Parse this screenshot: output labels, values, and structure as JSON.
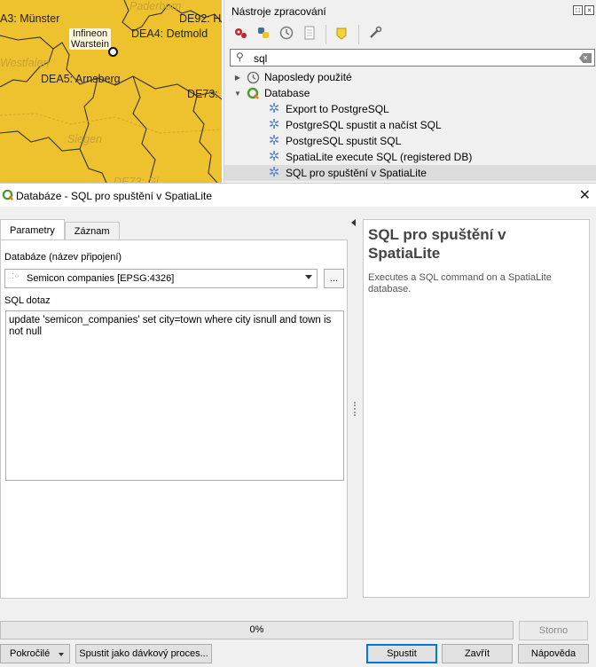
{
  "map": {
    "labels": [
      "A3: Münster",
      "Paderborn",
      "DE92: H",
      "DEA4: Detmold",
      "Westfalen",
      "DEA5: Arnsberg",
      "DE73:",
      "Siegen",
      "DE73: Gi"
    ],
    "poi_label_line1": "Infineon",
    "poi_label_line2": "Warstein"
  },
  "processing": {
    "title": "Nástroje zpracování",
    "window_controls": [
      "□",
      "×"
    ],
    "toolbar_icons": [
      "models-icon",
      "python-icon",
      "history-icon",
      "results-icon",
      "edit-features-icon",
      "options-icon"
    ],
    "search_value": "sql",
    "tree": [
      {
        "label": "Naposledy použité",
        "level": 0,
        "expanded": false,
        "icon": "clock-icon"
      },
      {
        "label": "Database",
        "level": 0,
        "expanded": true,
        "icon": "qgis-icon"
      },
      {
        "label": "Export to PostgreSQL",
        "level": 1,
        "icon": "gear-icon"
      },
      {
        "label": "PostgreSQL spustit a načíst SQL",
        "level": 1,
        "icon": "gear-icon"
      },
      {
        "label": "PostgreSQL spustit SQL",
        "level": 1,
        "icon": "gear-icon"
      },
      {
        "label": "SpatiaLite execute SQL (registered DB)",
        "level": 1,
        "icon": "gear-icon"
      },
      {
        "label": "SQL pro spuštění v SpatiaLite",
        "level": 1,
        "icon": "gear-icon",
        "selected": true
      }
    ]
  },
  "dialog": {
    "title": "Databáze - SQL pro spuštění v SpatiaLite",
    "tabs": [
      "Parametry",
      "Záznam"
    ],
    "db_label": "Databáze (název připojení)",
    "db_value": "Semicon companies [EPSG:4326]",
    "db_more": "...",
    "sql_label": "SQL dotaz",
    "sql_value": "update 'semicon_companies' set city=town where city isnull and town is not null",
    "help_title": "SQL pro spuštění v SpatiaLite",
    "help_text": "Executes a SQL command on a SpatiaLite database.",
    "progress": {
      "value": 0,
      "text": "0%"
    },
    "buttons": {
      "cancel": "Storno",
      "advanced": "Pokročilé",
      "batch": "Spustit jako dávkový proces...",
      "run": "Spustit",
      "close": "Zavřít",
      "help": "Nápověda"
    }
  },
  "colors": {
    "map_fill": "#eec12e",
    "progress_fill": "#06b025",
    "default_button_border": "#0078d7",
    "gear": "#5b86c9"
  }
}
